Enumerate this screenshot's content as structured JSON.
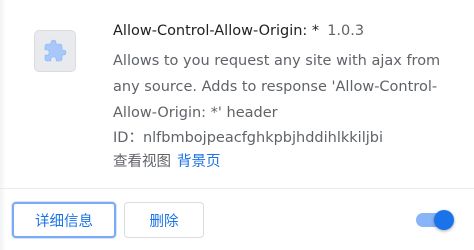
{
  "extension": {
    "icon": "puzzle-piece-icon",
    "name": "Allow-Control-Allow-Origin: *",
    "version": "1.0.3",
    "description": "Allows to you request any site with ajax from any source. Adds to response 'Allow-Control-Allow-Origin: *' header",
    "id_label": "ID：",
    "id_value": "nlfbmbojpeacfghkpbjhddihlkkiljbi",
    "inspect_label": "查看视图",
    "inspect_link": "背景页",
    "enabled": true
  },
  "actions": {
    "details_label": "详细信息",
    "remove_label": "删除"
  },
  "colors": {
    "accent": "#1a73e8",
    "toggle_track": "#8ab4f8",
    "icon_bg": "#e8eaed",
    "secondary_text": "#5f6368"
  }
}
